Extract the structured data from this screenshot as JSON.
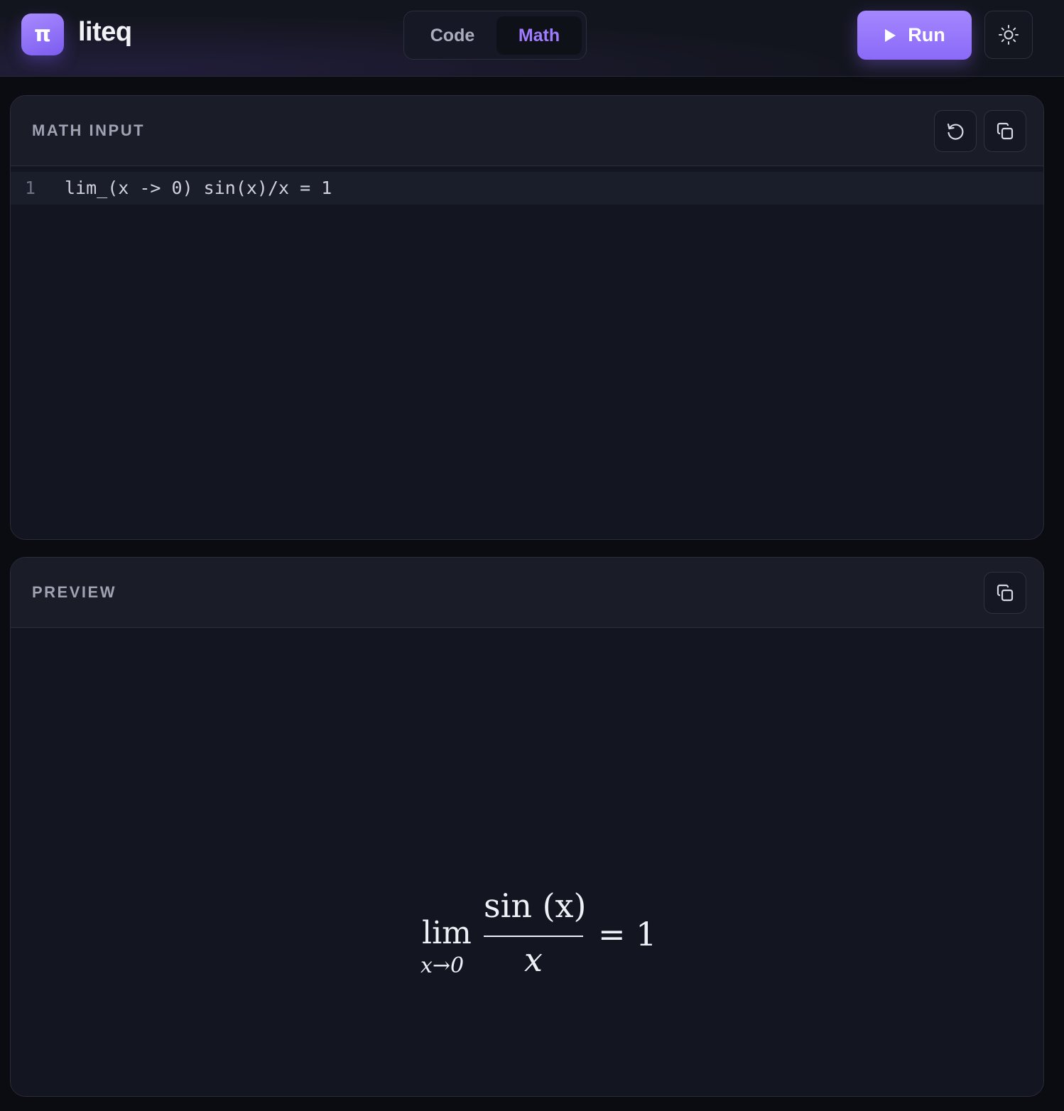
{
  "header": {
    "logo_glyph": "π",
    "app_name": "liteq",
    "tabs": [
      {
        "label": "Code",
        "active": false
      },
      {
        "label": "Math",
        "active": true
      }
    ],
    "run_label": "Run",
    "theme_icon": "sun-icon"
  },
  "input_panel": {
    "title": "MATH INPUT",
    "actions": [
      "reset-icon",
      "copy-icon"
    ],
    "lines": [
      {
        "number": "1",
        "text": "lim_(x -> 0) sin(x)/x = 1"
      }
    ]
  },
  "preview_panel": {
    "title": "PREVIEW",
    "actions": [
      "copy-icon"
    ],
    "formula": {
      "operator": "lim",
      "limit_sub": "x→0",
      "numerator": "sin (x)",
      "denominator": "x",
      "rhs": "= 1"
    }
  },
  "colors": {
    "accent": "#9f7bff",
    "run_button": "#8a6af7",
    "background": "#0b0c11",
    "panel": "#131620",
    "panel_header": "#1a1d27"
  }
}
